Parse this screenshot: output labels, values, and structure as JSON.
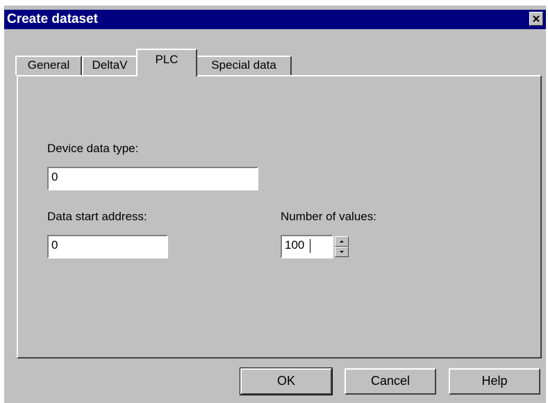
{
  "window": {
    "title": "Create dataset",
    "close_icon": "close-icon"
  },
  "tabs": [
    {
      "label": "General",
      "active": false
    },
    {
      "label": "DeltaV",
      "active": false
    },
    {
      "label": "PLC",
      "active": true
    },
    {
      "label": "Special data",
      "active": false
    }
  ],
  "form": {
    "device_data_type": {
      "label": "Device data type:",
      "value": "0"
    },
    "data_start_address": {
      "label": "Data start address:",
      "value": "0"
    },
    "number_of_values": {
      "label": "Number of values:",
      "value": "100"
    }
  },
  "buttons": {
    "ok": "OK",
    "cancel": "Cancel",
    "help": "Help"
  },
  "colors": {
    "face": "#c0c0c0",
    "title_bar": "#000080",
    "field": "#ffffff"
  }
}
